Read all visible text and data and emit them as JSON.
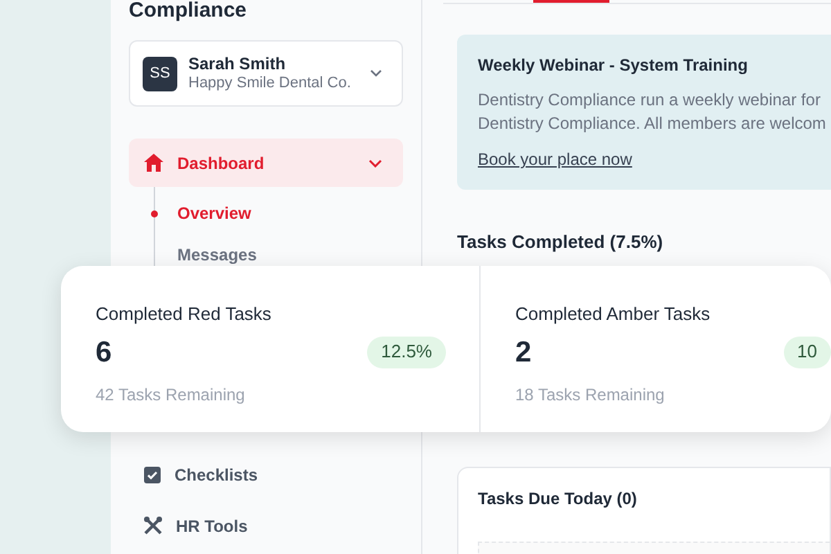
{
  "logo": {
    "text": "Compliance"
  },
  "user": {
    "initials": "SS",
    "name": "Sarah Smith",
    "organisation": "Happy Smile Dental Co."
  },
  "nav": [
    {
      "kind": "group",
      "label": "Dashboard",
      "selected": true,
      "expanded": true,
      "children": [
        {
          "label": "Overview",
          "selected": true
        },
        {
          "label": "Messages",
          "selected": false
        }
      ]
    },
    {
      "kind": "item",
      "label": "Checklists",
      "selected": false
    },
    {
      "kind": "item",
      "label": "HR Tools",
      "selected": false
    }
  ],
  "webinar": {
    "title": "Weekly Webinar - System Training",
    "body": "Dentistry Compliance run a weekly webinar for\nDentistry Compliance. All members are welcom",
    "link": "Book your place now"
  },
  "tasks_completed": {
    "title": "Tasks Completed (7.5%)"
  },
  "stats": [
    {
      "title": "Completed Red Tasks",
      "value": "6",
      "badge": "12.5%",
      "remaining": "42 Tasks Remaining"
    },
    {
      "title": "Completed Amber Tasks",
      "value": "2",
      "badge": "10",
      "remaining": "18 Tasks Remaining"
    }
  ],
  "tasks_due": {
    "title": "Tasks Due Today (0)"
  }
}
